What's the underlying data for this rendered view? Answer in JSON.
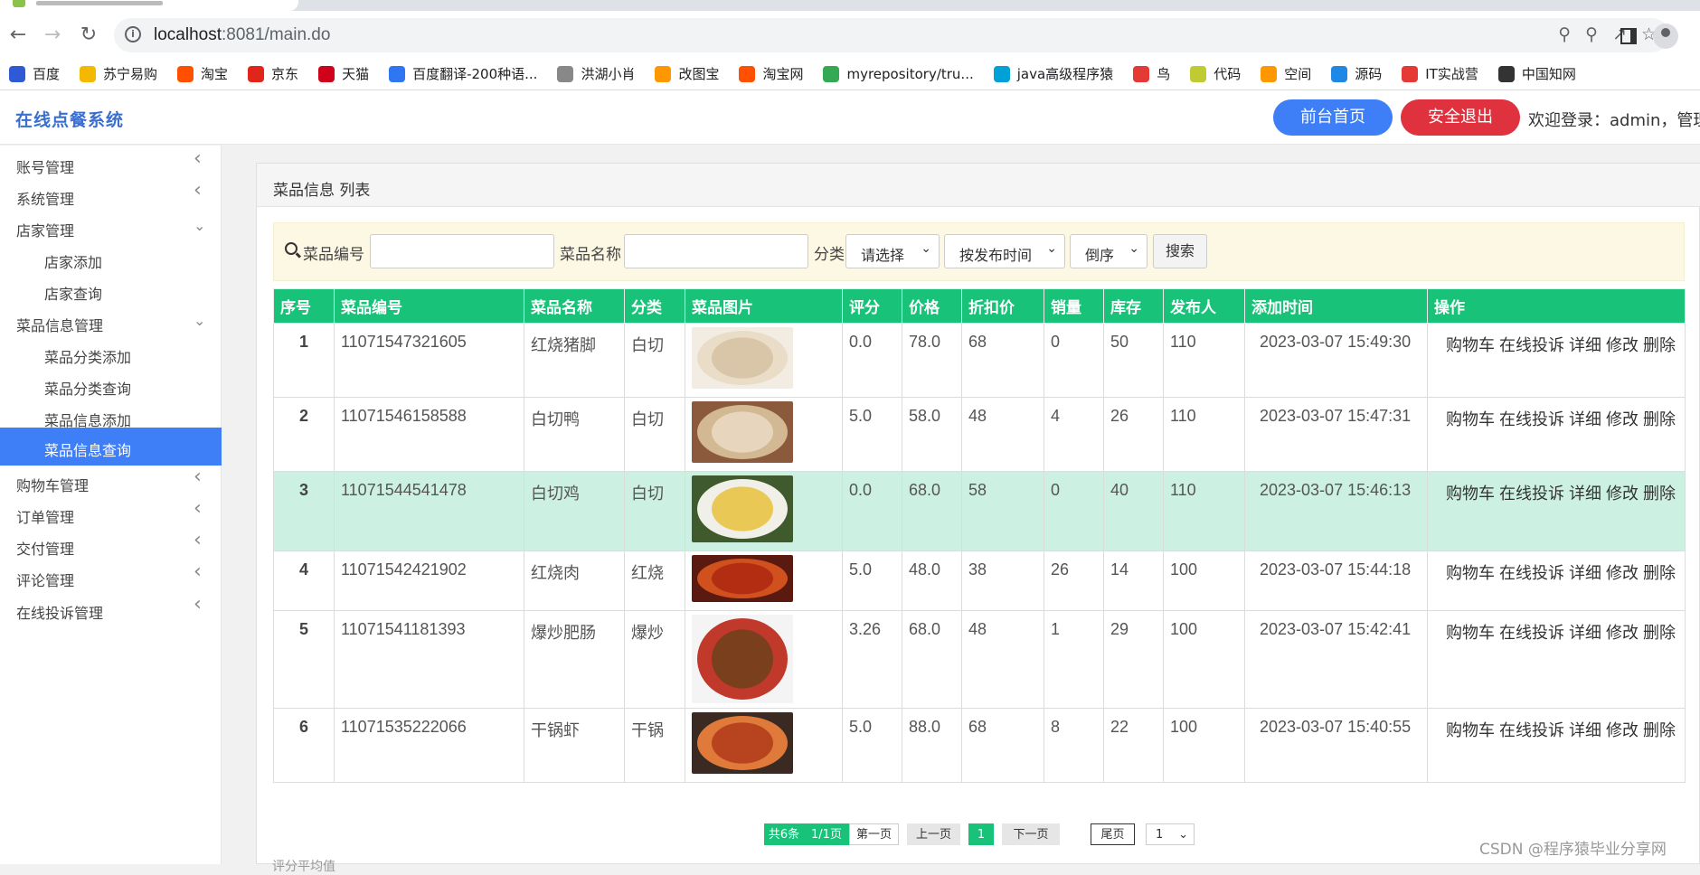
{
  "browser": {
    "url_host": "localhost",
    "url_path": ":8081/main.do",
    "bookmarks": [
      {
        "label": "百度",
        "color": "#2e5ad6"
      },
      {
        "label": "苏宁易购",
        "color": "#f5b800"
      },
      {
        "label": "淘宝",
        "color": "#ff5000"
      },
      {
        "label": "京东",
        "color": "#e1251b"
      },
      {
        "label": "天猫",
        "color": "#d0021b"
      },
      {
        "label": "百度翻译-200种语...",
        "color": "#2f77f2"
      },
      {
        "label": "洪湖小肖",
        "color": "#888888"
      },
      {
        "label": "改图宝",
        "color": "#ff9800"
      },
      {
        "label": "淘宝网",
        "color": "#ff5000"
      },
      {
        "label": "myrepository/tru...",
        "color": "#34a853"
      },
      {
        "label": "java高级程序猿",
        "color": "#00a1d6"
      },
      {
        "label": "鸟",
        "color": "#e53935"
      },
      {
        "label": "代码",
        "color": "#c0ca33"
      },
      {
        "label": "空间",
        "color": "#ff9800"
      },
      {
        "label": "源码",
        "color": "#1e88e5"
      },
      {
        "label": "IT实战营",
        "color": "#e53935"
      },
      {
        "label": "中国知网",
        "color": "#333333"
      }
    ]
  },
  "header": {
    "title": "在线点餐系统",
    "home_button": "前台首页",
    "logout_button": "安全退出",
    "welcome": "欢迎登录：admin，管理员"
  },
  "sidebar": {
    "items": [
      {
        "label": "账号管理",
        "type": "group",
        "expanded": false
      },
      {
        "label": "系统管理",
        "type": "group",
        "expanded": false
      },
      {
        "label": "店家管理",
        "type": "group",
        "expanded": true
      },
      {
        "label": "店家添加",
        "type": "sub"
      },
      {
        "label": "店家查询",
        "type": "sub"
      },
      {
        "label": "菜品信息管理",
        "type": "group",
        "expanded": true
      },
      {
        "label": "菜品分类添加",
        "type": "sub"
      },
      {
        "label": "菜品分类查询",
        "type": "sub"
      },
      {
        "label": "菜品信息添加",
        "type": "sub"
      },
      {
        "label": "菜品信息查询",
        "type": "sub",
        "active": true
      },
      {
        "label": "购物车管理",
        "type": "group",
        "expanded": false
      },
      {
        "label": "订单管理",
        "type": "group",
        "expanded": false
      },
      {
        "label": "交付管理",
        "type": "group",
        "expanded": false
      },
      {
        "label": "评论管理",
        "type": "group",
        "expanded": false
      },
      {
        "label": "在线投诉管理",
        "type": "group",
        "expanded": false
      }
    ]
  },
  "panel": {
    "title": "菜品信息 列表"
  },
  "search": {
    "code_label": "菜品编号",
    "name_label": "菜品名称",
    "category_label": "分类",
    "category_value": "请选择",
    "sort_field_value": "按发布时间",
    "sort_order_value": "倒序",
    "search_button": "搜索"
  },
  "table": {
    "columns": [
      "序号",
      "菜品编号",
      "菜品名称",
      "分类",
      "菜品图片",
      "评分",
      "价格",
      "折扣价",
      "销量",
      "库存",
      "发布人",
      "添加时间",
      "操作"
    ],
    "actions": [
      "购物车",
      "在线投诉",
      "详细",
      "修改",
      "删除"
    ],
    "rows": [
      {
        "idx": "1",
        "code": "11071547321605",
        "name": "红烧猪脚",
        "category": "白切",
        "image": "food-photo-pork-trotter",
        "rating": "0.0",
        "price": "78.0",
        "discount": "68",
        "sales": "0",
        "stock": "50",
        "publisher": "110",
        "time": "2023-03-07 15:49:30"
      },
      {
        "idx": "2",
        "code": "11071546158588",
        "name": "白切鸭",
        "category": "白切",
        "image": "food-photo-white-cut-duck",
        "rating": "5.0",
        "price": "58.0",
        "discount": "48",
        "sales": "4",
        "stock": "26",
        "publisher": "110",
        "time": "2023-03-07 15:47:31"
      },
      {
        "idx": "3",
        "code": "11071544541478",
        "name": "白切鸡",
        "category": "白切",
        "image": "food-photo-white-cut-chicken",
        "rating": "0.0",
        "price": "68.0",
        "discount": "58",
        "sales": "0",
        "stock": "40",
        "publisher": "110",
        "time": "2023-03-07 15:46:13"
      },
      {
        "idx": "4",
        "code": "11071542421902",
        "name": "红烧肉",
        "category": "红烧",
        "image": "food-photo-braised-pork",
        "rating": "5.0",
        "price": "48.0",
        "discount": "38",
        "sales": "26",
        "stock": "14",
        "publisher": "100",
        "time": "2023-03-07 15:44:18"
      },
      {
        "idx": "5",
        "code": "11071541181393",
        "name": "爆炒肥肠",
        "category": "爆炒",
        "image": "food-photo-stir-fried-intestine",
        "rating": "3.26",
        "price": "68.0",
        "discount": "48",
        "sales": "1",
        "stock": "29",
        "publisher": "100",
        "time": "2023-03-07 15:42:41"
      },
      {
        "idx": "6",
        "code": "11071535222066",
        "name": "干锅虾",
        "category": "干锅",
        "image": "food-photo-dry-pot-shrimp",
        "rating": "5.0",
        "price": "88.0",
        "discount": "68",
        "sales": "8",
        "stock": "22",
        "publisher": "100",
        "time": "2023-03-07 15:40:55"
      }
    ]
  },
  "pager": {
    "total": "共6条",
    "pages": "1/1页",
    "first": "第一页",
    "prev": "上一页",
    "current": "1",
    "next": "下一页",
    "last": "尾页",
    "jump_value": "1"
  },
  "watermark": "CSDN @程序猿毕业分享网",
  "bottom_text": "评分平均值"
}
